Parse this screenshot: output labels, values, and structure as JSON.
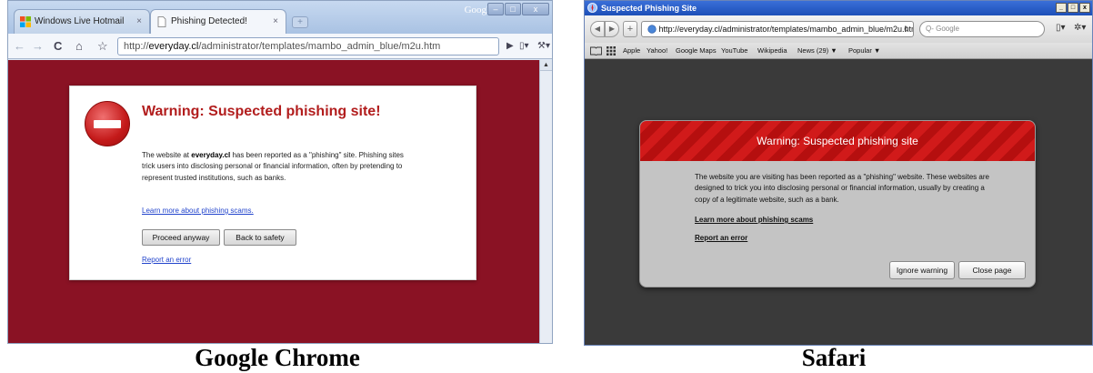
{
  "chrome": {
    "caption": "Google Chrome",
    "tabs": [
      {
        "label": "Windows Live Hotmail",
        "close": "×"
      },
      {
        "label": "Phishing Detected!",
        "close": "×"
      }
    ],
    "new_tab": "+",
    "brand": "Google",
    "window_buttons": [
      "–",
      "□",
      "x"
    ],
    "nav": {
      "back": "←",
      "forward": "→",
      "reload": "C",
      "home": "⌂",
      "star": "☆"
    },
    "url": {
      "scheme": "http://",
      "host": "everyday.cl",
      "path": "/administrator/templates/mambo_admin_blue/m2u.htm"
    },
    "toolbar_right": {
      "page": "▶",
      "page_menu": "▯▾",
      "wrench": "⚒▾"
    },
    "scroll_up": "▲",
    "warning": {
      "title": "Warning: Suspected phishing site!",
      "body_prefix": "The website at ",
      "body_host": "everyday.cl",
      "body_suffix": " has been reported as a \"phishing\" site. Phishing sites trick users into disclosing personal or financial information, often by pretending to represent trusted institutions, such as banks.",
      "learn_more": "Learn more about phishing scams.",
      "proceed_button": "Proceed anyway",
      "back_button": "Back to safety",
      "report_link": "Report an error"
    },
    "colors": {
      "background": "#8a1224",
      "title": "#b21d1d",
      "link": "#2244cc"
    }
  },
  "safari": {
    "caption": "Safari",
    "window_title": "Suspected Phishing Site",
    "window_buttons": [
      "_",
      "□",
      "x"
    ],
    "nav": {
      "back": "◀",
      "forward": "▶",
      "add": "+"
    },
    "url": "http://everyday.cl/administrator/templates/mambo_admin_blue/m2u.htm",
    "reload": "¢",
    "search_placeholder": "Q- Google",
    "toolbar_right": {
      "page": "▯▾",
      "gear": "✲▾"
    },
    "bookmarks": [
      "Apple",
      "Yahoo!",
      "Google Maps",
      "YouTube",
      "Wikipedia",
      "News (29) ▼",
      "Popular ▼"
    ],
    "warning": {
      "title": "Warning: Suspected phishing site",
      "body": "The website you are visiting has been reported as a \"phishing\" website. These websites are designed to trick you into disclosing personal or financial information, usually by creating a copy of a legitimate website, such as a bank.",
      "learn_more": "Learn more about phishing scams",
      "report_link": "Report an error",
      "ignore_button": "Ignore warning",
      "close_button": "Close page"
    },
    "colors": {
      "background": "#3a3a3a",
      "header": "#d11a1a",
      "box": "#c4c4c4"
    }
  }
}
